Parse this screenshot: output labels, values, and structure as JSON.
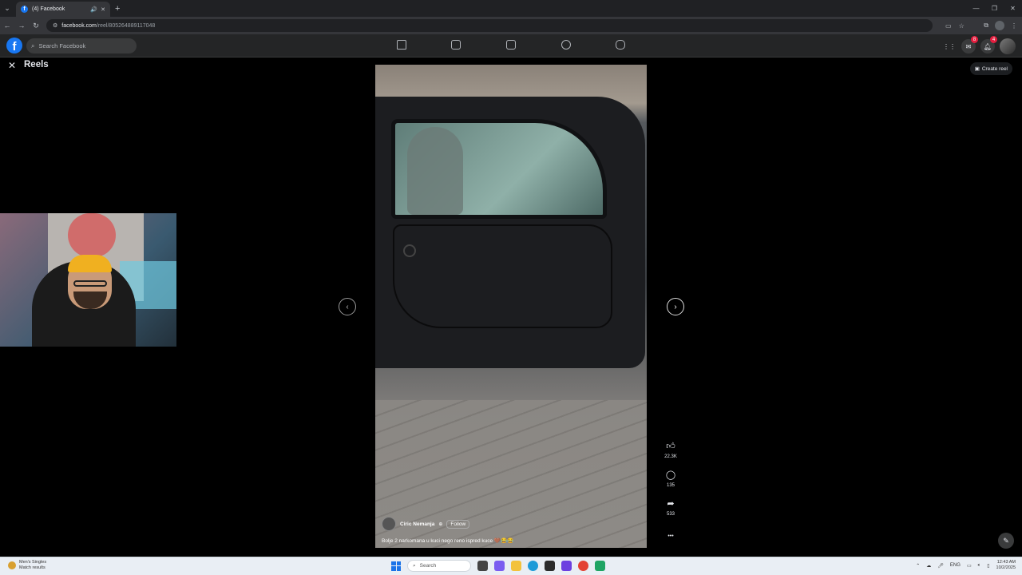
{
  "browser": {
    "tab_title": "(4) Facebook",
    "url_domain": "facebook.com",
    "url_path": "/reel/805264889117048"
  },
  "facebook": {
    "search_placeholder": "Search Facebook",
    "messenger_badge": "8",
    "notifications_badge": "4"
  },
  "reels": {
    "title": "Reels",
    "create_reel_label": "Create reel"
  },
  "reel": {
    "author": "Ciric Nemanja",
    "follow_label": "Follow",
    "caption": "Bolje 2 narkomana u kuci nego reno ispred kuce 🤎😂😂",
    "likes": "22.3K",
    "comments": "135",
    "shares": "533",
    "more": "•••"
  },
  "taskbar": {
    "widget_title": "Men's Singles",
    "widget_sub": "Match results",
    "search_placeholder": "Search",
    "lang": "ENG",
    "time": "12:43 AM",
    "date": "10/2/2025"
  }
}
